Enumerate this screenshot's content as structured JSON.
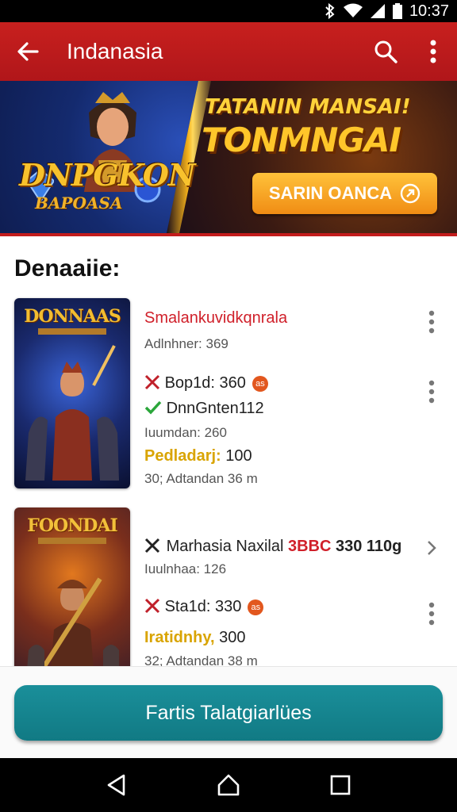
{
  "status_bar": {
    "time": "10:37",
    "icons": [
      "bluetooth-icon",
      "wifi-icon",
      "signal-icon",
      "battery-icon"
    ]
  },
  "app_bar": {
    "title": "Indanasia",
    "actions": [
      "search-icon",
      "more-vert-icon"
    ]
  },
  "banner": {
    "logo_line1": "DNPGKON",
    "logo_line2": "BAPOASA",
    "heading_line1": "TATANIN MANSAI!",
    "heading_line2": "TONMNGAI",
    "cta_label": "SARIN OANCA"
  },
  "section": {
    "title": "Denaaiie:"
  },
  "items": [
    {
      "thumb_title": "DONNAAS",
      "title": "Smalankuvidkqnrala",
      "subtitle": "Adlnhner: 369",
      "stat1_label": "Bop1d: 360",
      "stat2_label": "DnnGnten112",
      "stat3_label": "Iuumdan: 260",
      "rating_label": "Pedladarj:",
      "rating_value": "100",
      "footer": "30; Adtandan 36 m"
    },
    {
      "thumb_title": "FOONDAI",
      "title_prefix": "Marhasia Naxilal",
      "title_red": "3BBC",
      "title_suffix": "330 110g",
      "subtitle": "Iuulnhaa: 126",
      "stat1_label": "Sta1d: 330",
      "rating_label": "Iratidnhy,",
      "rating_value": "300",
      "footer": "32; Adtandan 38 m"
    }
  ],
  "bottom_button": {
    "label": "Fartis Talatgiarlües"
  },
  "colors": {
    "app_bar": "#c31c1c",
    "accent": "#117a84",
    "cta": "#f59a1c",
    "link_red": "#d0202a",
    "rating_yellow": "#d9a400"
  },
  "nav": [
    "back-triangle-icon",
    "home-icon",
    "recents-icon"
  ]
}
